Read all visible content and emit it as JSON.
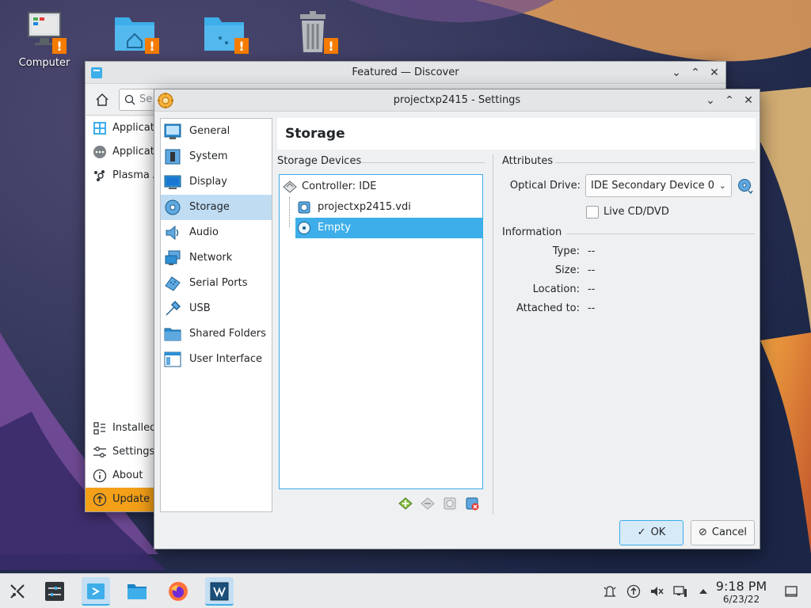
{
  "desktop": {
    "icons": [
      {
        "label": "Computer"
      },
      {
        "label": ""
      },
      {
        "label": ""
      },
      {
        "label": ""
      }
    ]
  },
  "discover": {
    "title": "Featured — Discover",
    "search_placeholder": "Se",
    "sidebar_items": [
      {
        "label": "Applicati",
        "icon": "grid-icon"
      },
      {
        "label": "Applicati",
        "icon": "dots-icon"
      },
      {
        "label": "Plasma A",
        "icon": "plasma-icon"
      }
    ],
    "bottom_items": [
      {
        "label": "Installed",
        "icon": "installed-icon"
      },
      {
        "label": "Settings",
        "icon": "settings-icon"
      },
      {
        "label": "About",
        "icon": "info-icon"
      },
      {
        "label": "Update",
        "icon": "update-icon"
      }
    ]
  },
  "settings": {
    "title": "projectxp2415 - Settings",
    "categories": [
      {
        "label": "General",
        "icon": "general-icon"
      },
      {
        "label": "System",
        "icon": "system-icon"
      },
      {
        "label": "Display",
        "icon": "display-icon"
      },
      {
        "label": "Storage",
        "icon": "storage-icon",
        "active": true
      },
      {
        "label": "Audio",
        "icon": "audio-icon"
      },
      {
        "label": "Network",
        "icon": "network-icon"
      },
      {
        "label": "Serial Ports",
        "icon": "serial-ports-icon"
      },
      {
        "label": "USB",
        "icon": "usb-icon"
      },
      {
        "label": "Shared Folders",
        "icon": "shared-folders-icon"
      },
      {
        "label": "User Interface",
        "icon": "user-interface-icon"
      }
    ],
    "page_title": "Storage",
    "storage_devices_label": "Storage Devices",
    "tree": {
      "controller": "Controller: IDE",
      "items": [
        {
          "label": "projectxp2415.vdi",
          "icon": "hard-disk-icon"
        },
        {
          "label": "Empty",
          "icon": "optical-disc-icon",
          "selected": true
        }
      ]
    },
    "attributes_label": "Attributes",
    "optical_drive_label": "Optical Drive:",
    "optical_drive_value": "IDE Secondary Device 0",
    "live_cd_label": "Live CD/DVD",
    "information_label": "Information",
    "info": [
      {
        "label": "Type:",
        "value": "--"
      },
      {
        "label": "Size:",
        "value": "--"
      },
      {
        "label": "Location:",
        "value": "--"
      },
      {
        "label": "Attached to:",
        "value": "--"
      }
    ],
    "ok_label": "OK",
    "cancel_label": "Cancel"
  },
  "taskbar": {
    "time": "9:18 PM",
    "date": "6/23/22"
  },
  "colors": {
    "accent": "#3daee9",
    "selection": "#bfdcf2",
    "update": "#f4a018"
  }
}
